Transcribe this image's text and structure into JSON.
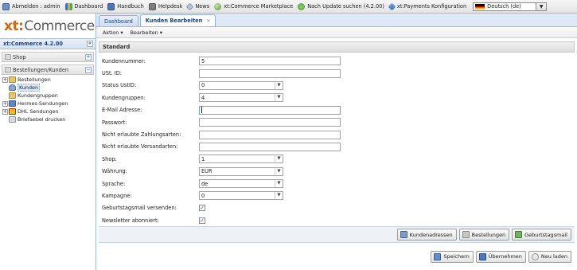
{
  "topbar": {
    "items": [
      {
        "label": "Abmelden : admin"
      },
      {
        "label": "Dashboard"
      },
      {
        "label": "Handbuch"
      },
      {
        "label": "Helpdesk"
      },
      {
        "label": "News"
      },
      {
        "label": "xt:Commerce Marketplace"
      },
      {
        "label": "Nach Update suchen (4.2.00)"
      },
      {
        "label": "xt:Payments Konfiguration"
      }
    ],
    "language": "Deutsch (de)"
  },
  "sidebar": {
    "logo": {
      "xt": "xt:",
      "commerce": "Commerce",
      "version": "4"
    },
    "header": "xt:Commerce 4.2.00",
    "shop_section": "Shop",
    "orders_section": "Bestellungen/Kunden",
    "tree": [
      {
        "label": "Bestellungen"
      },
      {
        "label": "Kunden"
      },
      {
        "label": "Kundengruppen"
      },
      {
        "label": "Hermes-Sendungen"
      },
      {
        "label": "DHL Sendungen"
      },
      {
        "label": "Briefaebel drucken"
      }
    ]
  },
  "main": {
    "tabs": [
      {
        "label": "Dashboard"
      },
      {
        "label": "Kunden Bearbeiten"
      }
    ],
    "actions": [
      "Aktion",
      "Bearbeiten"
    ],
    "section": "Standard",
    "fields": {
      "kundennummer": {
        "label": "Kundennummer:",
        "value": "5"
      },
      "ust_id": {
        "label": "USt. ID:",
        "value": ""
      },
      "status_ustid": {
        "label": "Status UstID:",
        "value": "0"
      },
      "kundengruppen": {
        "label": "Kundengruppen:",
        "value": "4"
      },
      "email": {
        "label": "E-Mail Adresse:",
        "value": ""
      },
      "passwort": {
        "label": "Passwort:",
        "value": ""
      },
      "zahlungsarten": {
        "label": "Nicht erlaubte Zahlungsarten:",
        "value": ""
      },
      "versandarten": {
        "label": "Nicht erlaubte Versandarten:",
        "value": ""
      },
      "shop": {
        "label": "Shop:",
        "value": "1"
      },
      "waehrung": {
        "label": "Währung:",
        "value": "EUR"
      },
      "sprache": {
        "label": "Sprache:",
        "value": "de"
      },
      "kampagne": {
        "label": "Kampagne:",
        "value": "0"
      },
      "geburtstagsmail": {
        "label": "Geburtstagsmail versenden:",
        "checked": true
      },
      "newsletter": {
        "label": "Newsletter abonniert:",
        "checked": true
      }
    },
    "buttons_row1": [
      "Kundenadressen",
      "Bestellungen",
      "Geburtstagsmail"
    ],
    "buttons_row2": [
      "Speichern",
      "Übernehmen",
      "Neu laden"
    ]
  }
}
